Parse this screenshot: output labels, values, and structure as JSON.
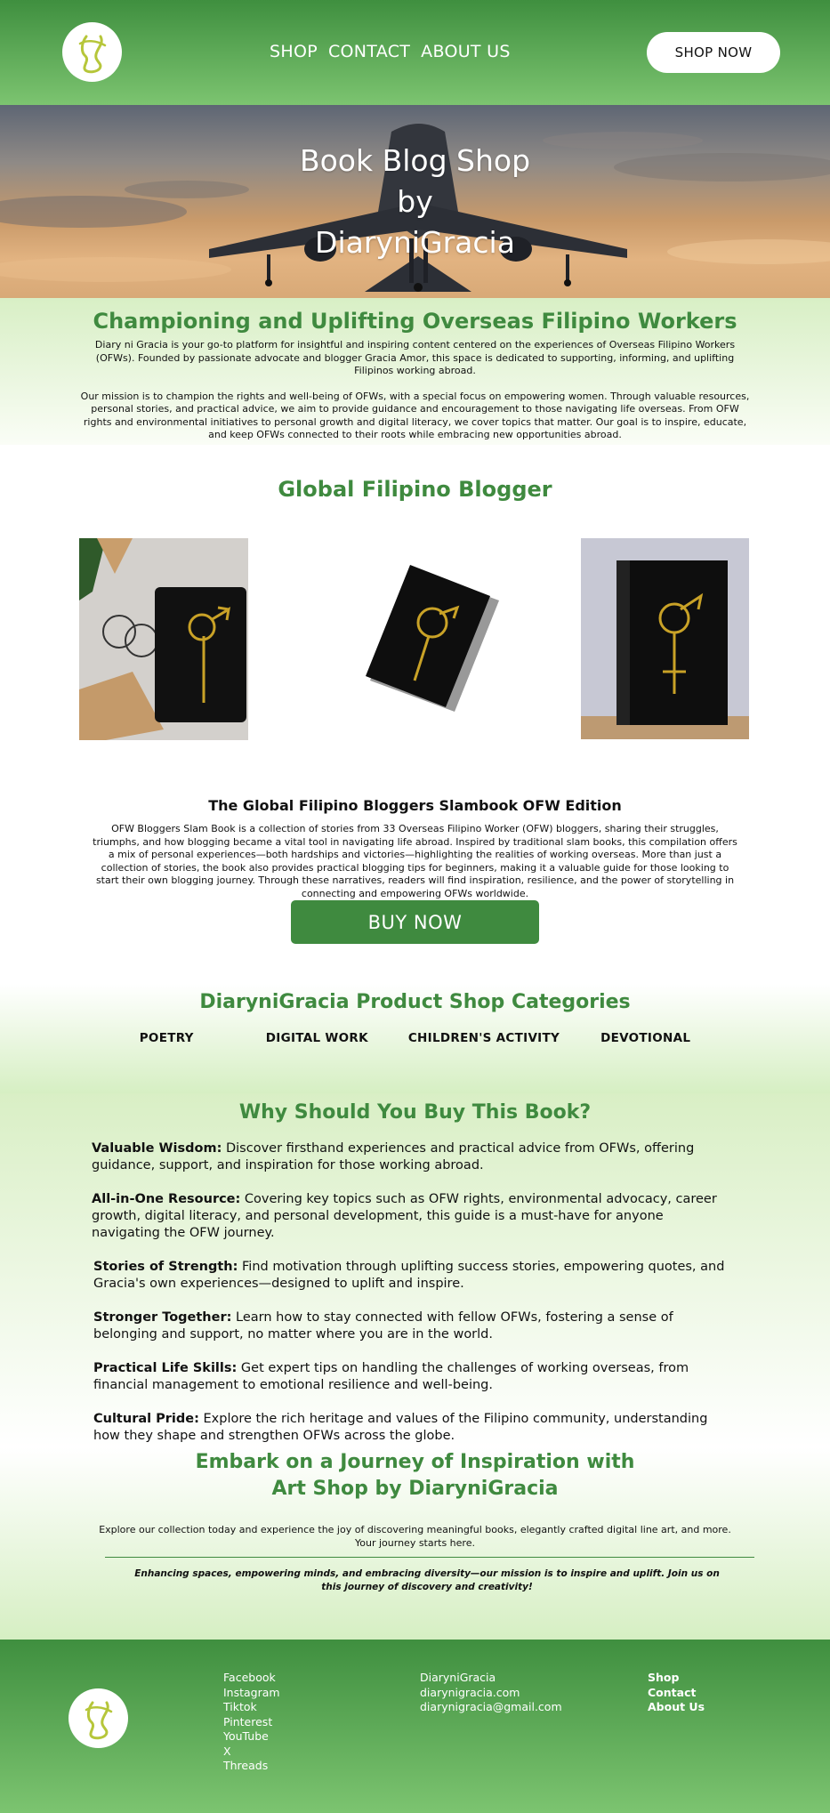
{
  "header": {
    "logo_icon": "diaryni-gracia-logo-icon",
    "nav": [
      "SHOP",
      "CONTACT",
      "ABOUT US"
    ],
    "cta_label": "SHOP NOW"
  },
  "hero": {
    "title_lines": [
      "Book Blog Shop",
      "by",
      "DiaryniGracia"
    ],
    "background_icon": "airplane-sunset-photo"
  },
  "mission": {
    "heading": "Championing and Uplifting Overseas Filipino Workers",
    "paragraph1": "Diary ni Gracia is your go-to platform for insightful and inspiring content centered on the experiences of Overseas Filipino Workers (OFWs). Founded by passionate advocate and blogger Gracia Amor, this space is dedicated to supporting, informing, and uplifting Filipinos working abroad.",
    "paragraph2": "Our mission is to champion the rights and well-being of OFWs, with a special focus on empowering women. Through valuable resources, personal stories, and practical advice, we aim to provide guidance and encouragement to those navigating life overseas. From OFW rights and environmental initiatives to personal growth and digital literacy, we cover topics that matter. Our goal is to inspire, educate, and keep OFWs connected to their roots while embracing new opportunities abroad."
  },
  "blogger": {
    "heading": "Global Filipino Blogger",
    "book_title": "The Global Filipino Bloggers Slambook OFW Edition",
    "book_description": "OFW Bloggers Slam Book is a collection of stories from 33 Overseas Filipino Worker (OFW) bloggers, sharing their struggles, triumphs, and how blogging became a vital tool in navigating life abroad. Inspired by traditional slam books, this compilation offers a mix of personal experiences—both hardships and victories—highlighting the realities of working overseas. More than just a collection of stories, the book also provides practical blogging tips for beginners, making it a valuable guide for those looking to start their own blogging journey. Through these narratives, readers will find inspiration, resilience, and the power of storytelling in connecting and empowering OFWs worldwide.",
    "buy_label": "BUY NOW"
  },
  "categories": {
    "heading": "DiaryniGracia Product Shop Categories",
    "items": [
      "POETRY",
      "DIGITAL WORK",
      "CHILDREN'S ACTIVITY",
      "DEVOTIONAL"
    ]
  },
  "why": {
    "heading": "Why Should You Buy This Book?",
    "items": [
      {
        "title": "Valuable Wisdom:",
        "text": " Discover firsthand experiences and practical advice from OFWs, offering guidance, support, and inspiration for those working abroad."
      },
      {
        "title": "All-in-One Resource:",
        "text": " Covering key topics such as OFW rights, environmental advocacy, career growth, digital literacy, and personal development, this guide is a must-have for anyone navigating the OFW journey."
      },
      {
        "title": "Stories of Strength:",
        "text": " Find motivation through uplifting success stories, empowering quotes, and Gracia's own experiences—designed to uplift and inspire."
      },
      {
        "title": "Stronger Together:",
        "text": " Learn how to stay connected with fellow OFWs, fostering a sense of belonging and support, no matter where you are in the world."
      },
      {
        "title": "Practical Life Skills:",
        "text": " Get expert tips on handling the challenges of working overseas, from financial management to emotional resilience and well-being."
      },
      {
        "title": "Cultural Pride:",
        "text": " Explore the rich heritage and values of the Filipino community, understanding how they shape and strengthen OFWs across the globe."
      }
    ]
  },
  "embark": {
    "heading_line1": "Embark on a Journey of Inspiration with",
    "heading_line2": "Art Shop by DiaryniGracia",
    "paragraph": "Explore our collection today and experience the joy of discovering meaningful books, elegantly crafted digital line art, and more. Your journey starts here.",
    "quote": "Enhancing spaces, empowering minds, and embracing diversity—our mission is to inspire and uplift. Join us on this journey of discovery and creativity!"
  },
  "footer": {
    "social": [
      "Facebook",
      "Instagram",
      "Tiktok",
      "Pinterest",
      "YouTube",
      "X",
      "Threads"
    ],
    "contact": [
      "DiaryniGracia",
      "diarynigracia.com",
      "diarynigracia@gmail.com"
    ],
    "links": [
      "Shop",
      "Contact",
      "About Us"
    ]
  },
  "colors": {
    "brand_green": "#3f8a3f",
    "light_green": "#d6efc3",
    "logo_yellow_green": "#b6c63a"
  }
}
